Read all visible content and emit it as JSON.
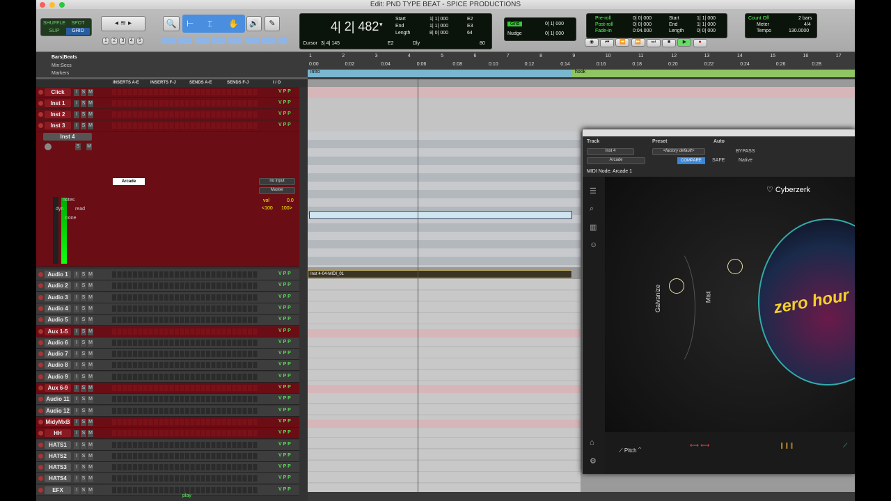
{
  "window": {
    "title": "Edit: PND TYPE BEAT - SPICE PRODUCTIONS"
  },
  "toolbar": {
    "modes": [
      "SHUFFLE",
      "SPOT",
      "SLIP",
      "GRID"
    ],
    "zoom_presets": [
      "1",
      "2",
      "3",
      "4",
      "5"
    ],
    "counter": {
      "main": "4| 2| 482",
      "cursor_label": "Cursor",
      "cursor_val": "3| 4| 145",
      "start_label": "Start",
      "end_label": "End",
      "length_label": "Length",
      "start": "1| 1| 000",
      "end": "1| 1| 000",
      "length": "8| 0| 000",
      "start2": "E2",
      "end2": "E3",
      "length2": "64",
      "e2b": "E2",
      "dly": "Dly",
      "tempo_val": "80"
    },
    "grid": {
      "label": "Grid",
      "value": "0| 1| 000",
      "nudge_label": "Nudge",
      "nudge_value": "0| 1| 000"
    },
    "preroll": {
      "pre_label": "Pre-roll",
      "pre": "0| 0| 000",
      "post_label": "Post-roll",
      "post": "0| 0| 000",
      "fade_label": "Fade-in",
      "fade": "0:04.000",
      "start_label": "Start",
      "start": "1| 1| 000",
      "end_label": "End",
      "end": "1| 1| 000",
      "length_label": "Length",
      "length": "0| 0| 000"
    },
    "countoff": {
      "label": "Count Off",
      "value": "2 bars",
      "meter_label": "Meter",
      "meter": "4/4",
      "tempo_label": "Tempo",
      "tempo": "130.0000"
    }
  },
  "rulers": {
    "bars_beats": "Bars|Beats",
    "min_secs": "Min:Secs",
    "markers": "Markers"
  },
  "mix_header": {
    "inserts_ae": "INSERTS A-E",
    "inserts_fj": "INSERTS F-J",
    "sends_ae": "SENDS A-E",
    "sends_fj": "SENDS F-J",
    "io": "I / O"
  },
  "tracks": [
    {
      "name": "Click",
      "color": "red"
    },
    {
      "name": "Inst 1",
      "color": "red"
    },
    {
      "name": "Inst 2",
      "color": "red"
    },
    {
      "name": "Inst 3",
      "color": "red"
    }
  ],
  "inst4": {
    "name": "Inst 4",
    "insert": "Arcade",
    "io_in": "no input",
    "io_out": "Master",
    "vol_label": "vol",
    "vol": "0.0",
    "pan_l": "<100",
    "pan_r": "100>",
    "notes": "notes",
    "dyn": "dyn",
    "read": "read",
    "none": "none"
  },
  "tracks2": [
    {
      "name": "Audio 1",
      "color": "grey"
    },
    {
      "name": "Audio 2",
      "color": "grey"
    },
    {
      "name": "Audio 3",
      "color": "grey"
    },
    {
      "name": "Audio 4",
      "color": "grey"
    },
    {
      "name": "Audio 5",
      "color": "grey"
    },
    {
      "name": "Aux 1-5",
      "color": "red"
    },
    {
      "name": "Audio 6",
      "color": "grey"
    },
    {
      "name": "Audio 7",
      "color": "grey"
    },
    {
      "name": "Audio 8",
      "color": "grey"
    },
    {
      "name": "Audio 9",
      "color": "grey"
    },
    {
      "name": "Aux 6-9",
      "color": "red"
    },
    {
      "name": "Audio 11",
      "color": "grey"
    },
    {
      "name": "Audio 12",
      "color": "grey"
    },
    {
      "name": "MidyMxB",
      "color": "red"
    },
    {
      "name": "HH",
      "color": "red"
    },
    {
      "name": "HATS1",
      "color": "grey"
    },
    {
      "name": "HATS2",
      "color": "grey"
    },
    {
      "name": "HATS3",
      "color": "grey"
    },
    {
      "name": "HATS4",
      "color": "grey"
    },
    {
      "name": "EFX",
      "color": "grey"
    }
  ],
  "ruler": {
    "bars": [
      "1",
      "2",
      "3",
      "4",
      "5",
      "6",
      "7",
      "8",
      "9",
      "10",
      "11",
      "12",
      "13",
      "14",
      "15",
      "16",
      "17"
    ],
    "times": [
      "0:00",
      "0:02",
      "0:04",
      "0:06",
      "0:08",
      "0:10",
      "0:12",
      "0:14",
      "0:16",
      "0:18",
      "0:20",
      "0:22",
      "0:24",
      "0:26",
      "0:28"
    ],
    "marker1": "intro",
    "marker2": "hook"
  },
  "clip": {
    "name": "Inst 4-04-MIDI_01"
  },
  "status": {
    "play": "play"
  },
  "plugin": {
    "track_label": "Track",
    "preset_label": "Preset",
    "auto_label": "Auto",
    "track": "Inst 4",
    "insert": "Arcade",
    "preset": "<factory default>",
    "compare": "COMPARE",
    "bypass": "BYPASS",
    "safe": "SAFE",
    "native": "Native",
    "node": "MIDI Node: Arcade 1",
    "kit": "Cyberzerk",
    "knob1": "Galvanize",
    "knob2": "Mist",
    "art": "zero hour",
    "pitch": "Pitch"
  },
  "colors": {
    "red_track": "#6a0d14",
    "accent_green": "#5f5"
  }
}
